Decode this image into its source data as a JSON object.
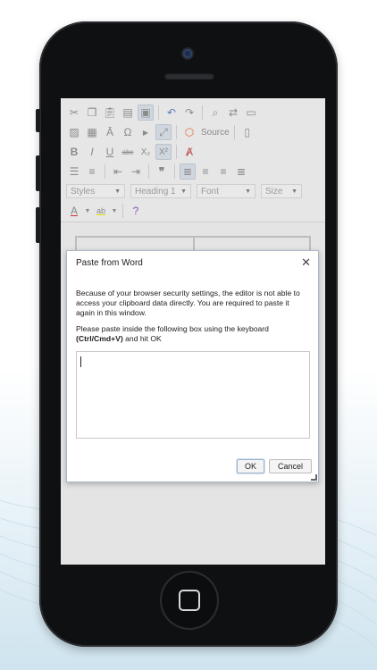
{
  "toolbar": {
    "row1": [
      "cut-icon",
      "copy-icon",
      "paste-icon",
      "paste-text-icon",
      "paste-word-icon",
      "undo-icon",
      "redo-icon",
      "find-icon",
      "replace-icon",
      "select-all-icon"
    ],
    "row2": {
      "source_label": "Source"
    },
    "row3": [
      "bold-icon",
      "italic-icon",
      "underline-icon",
      "strike-icon",
      "subscript-icon",
      "superscript-icon",
      "remove-format-icon"
    ],
    "combos": {
      "styles": "Styles",
      "format": "Heading 1",
      "font": "Font",
      "size": "Size"
    }
  },
  "dialog": {
    "title": "Paste from Word",
    "close_glyph": "✕",
    "message": "Because of your browser security settings, the editor is not able to access your clipboard data directly. You are required to paste it again in this window.",
    "instruction_prefix": "Please paste inside the following box using the keyboard ",
    "shortcut": "(Ctrl/Cmd+V)",
    "instruction_suffix": " and hit OK",
    "textarea_value": "",
    "ok_label": "OK",
    "cancel_label": "Cancel"
  }
}
